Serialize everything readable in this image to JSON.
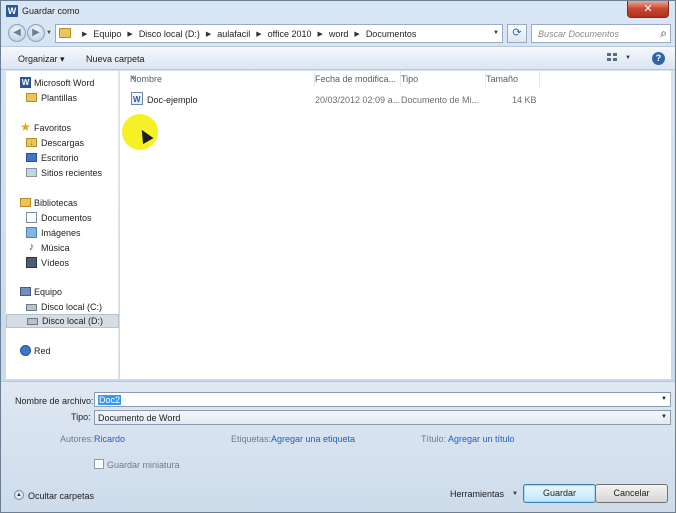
{
  "window": {
    "title": "Guardar como",
    "close_label": "✕"
  },
  "address": {
    "crumbs": [
      "Equipo",
      "Disco local (D:)",
      "aulafacil",
      "office 2010",
      "word",
      "Documentos"
    ]
  },
  "search": {
    "placeholder": "Buscar Documentos"
  },
  "toolbar": {
    "organizar": "Organizar  ▾",
    "nueva_carpeta": "Nueva carpeta",
    "help": "?"
  },
  "nav": {
    "items": [
      {
        "label": "Microsoft Word",
        "icon": "word-icon",
        "level": 0
      },
      {
        "label": "Plantillas",
        "icon": "folder-icon",
        "level": 1
      },
      {
        "label": "Favoritos",
        "icon": "star-icon",
        "level": 0
      },
      {
        "label": "Descargas",
        "icon": "downloads-folder-icon",
        "level": 1
      },
      {
        "label": "Escritorio",
        "icon": "desktop-icon",
        "level": 1
      },
      {
        "label": "Sitios recientes",
        "icon": "recent-places-icon",
        "level": 1
      },
      {
        "label": "Bibliotecas",
        "icon": "libraries-icon",
        "level": 0
      },
      {
        "label": "Documentos",
        "icon": "documents-icon",
        "level": 1
      },
      {
        "label": "Imágenes",
        "icon": "pictures-icon",
        "level": 1
      },
      {
        "label": "Música",
        "icon": "music-icon",
        "level": 1
      },
      {
        "label": "Vídeos",
        "icon": "videos-icon",
        "level": 1
      },
      {
        "label": "Equipo",
        "icon": "computer-icon",
        "level": 0
      },
      {
        "label": "Disco local (C:)",
        "icon": "drive-icon",
        "level": 1
      },
      {
        "label": "Disco local (D:)",
        "icon": "drive-icon",
        "level": 1,
        "selected": true
      },
      {
        "label": "Red",
        "icon": "network-icon",
        "level": 0
      }
    ]
  },
  "columns": {
    "name": "Nombre",
    "date": "Fecha de modifica...",
    "type": "Tipo",
    "size": "Tamaño"
  },
  "files": [
    {
      "name": "Doc-ejemplo",
      "date": "20/03/2012 02:09 a...",
      "type": "Documento de Mi...",
      "size": "14 KB"
    }
  ],
  "form": {
    "filename_label": "Nombre de archivo:",
    "filename_value": "Doc2",
    "type_label": "Tipo:",
    "type_value": "Documento de Word",
    "authors_label": "Autores:",
    "authors_value": "Ricardo",
    "tags_label": "Etiquetas:",
    "tags_value": "Agregar una etiqueta",
    "title_label": "Título:",
    "title_value": "Agregar un título",
    "thumbnail_label": "Guardar miniatura",
    "hide_folders": "Ocultar carpetas",
    "tools": "Herramientas",
    "save": "Guardar",
    "cancel": "Cancelar"
  }
}
